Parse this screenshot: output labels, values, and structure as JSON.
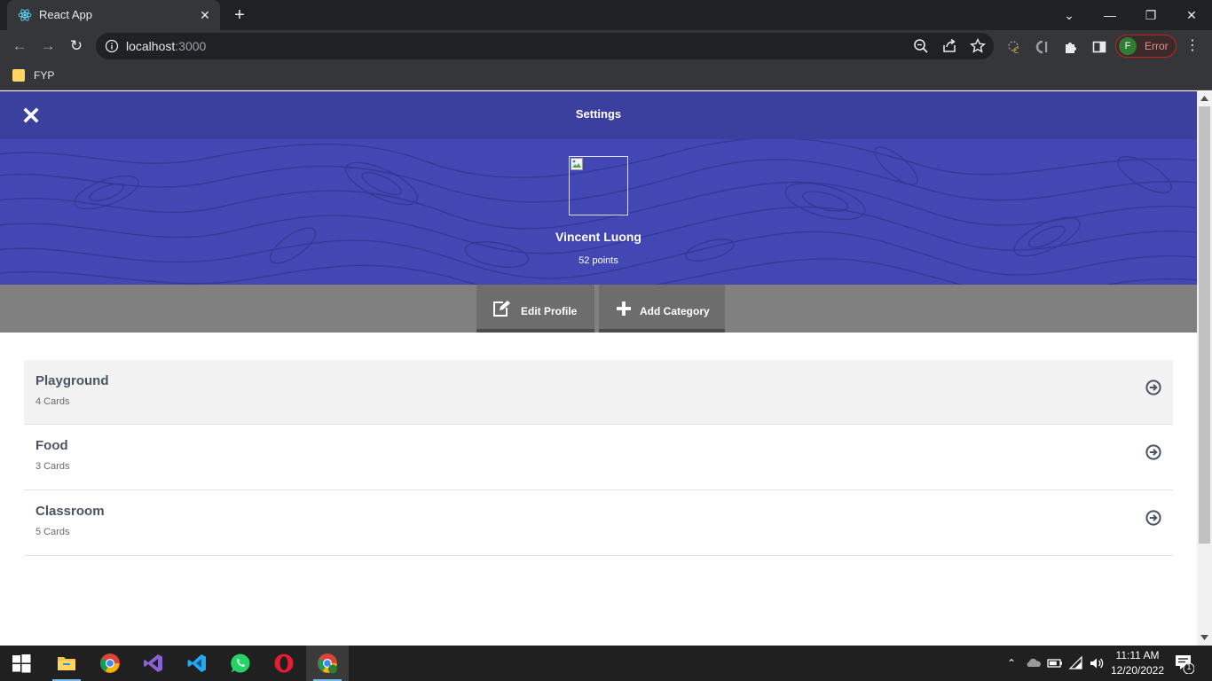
{
  "browser": {
    "tab_title": "React App",
    "url_host": "localhost",
    "url_port": ":3000",
    "bookmark_label": "FYP",
    "profile_initial": "F",
    "profile_status": "Error"
  },
  "header": {
    "title": "Settings"
  },
  "profile": {
    "name": "Vincent Luong",
    "points": "52 points"
  },
  "actions": {
    "edit_profile": "Edit Profile",
    "add_category": "Add Category"
  },
  "categories": [
    {
      "name": "Playground",
      "count": "4 Cards"
    },
    {
      "name": "Food",
      "count": "3 Cards"
    },
    {
      "name": "Classroom",
      "count": "5 Cards"
    }
  ],
  "taskbar": {
    "time": "11:11 AM",
    "date": "12/20/2022",
    "notification_count": "1"
  },
  "colors": {
    "header": "#3b3f9e",
    "banner": "#4247b3",
    "action_bar": "#808080",
    "list_text": "#4b5563"
  }
}
